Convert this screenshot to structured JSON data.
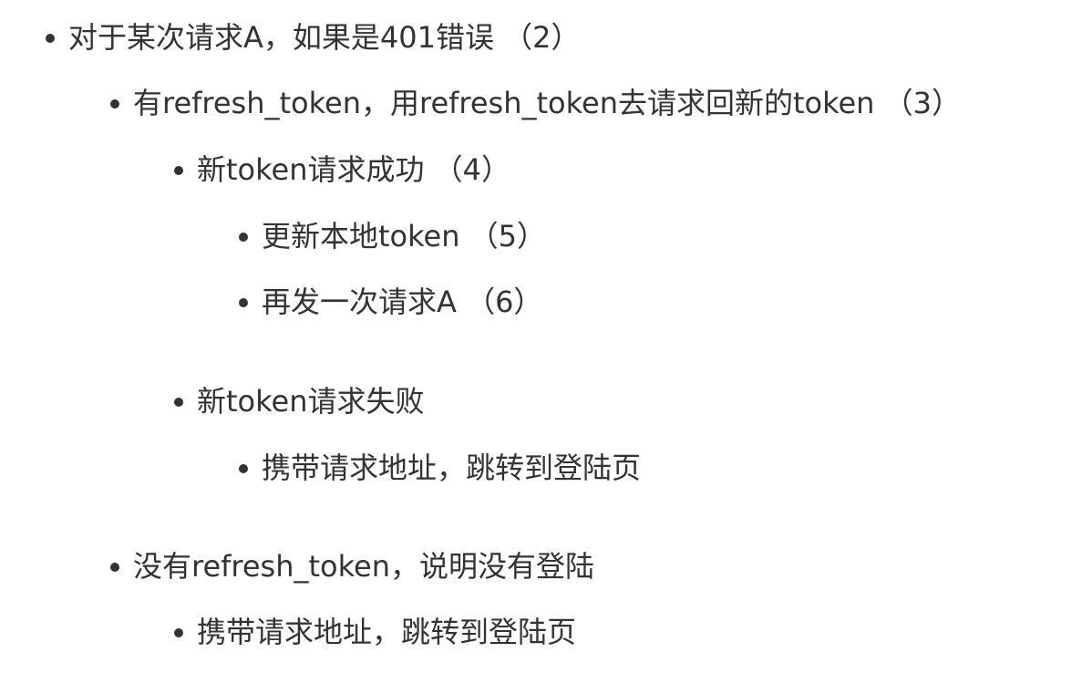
{
  "outline": {
    "items": [
      {
        "text": "对于某次请求A，如果是401错误 （2）"
      },
      {
        "text": "有refresh_token，用refresh_token去请求回新的token （3）"
      },
      {
        "text": "新token请求成功 （4）"
      },
      {
        "text": "更新本地token （5）"
      },
      {
        "text": "再发一次请求A （6）"
      },
      {
        "text": "新token请求失败"
      },
      {
        "text": "携带请求地址，跳转到登陆页"
      },
      {
        "text": "没有refresh_token，说明没有登陆"
      },
      {
        "text": "携带请求地址，跳转到登陆页"
      }
    ]
  }
}
